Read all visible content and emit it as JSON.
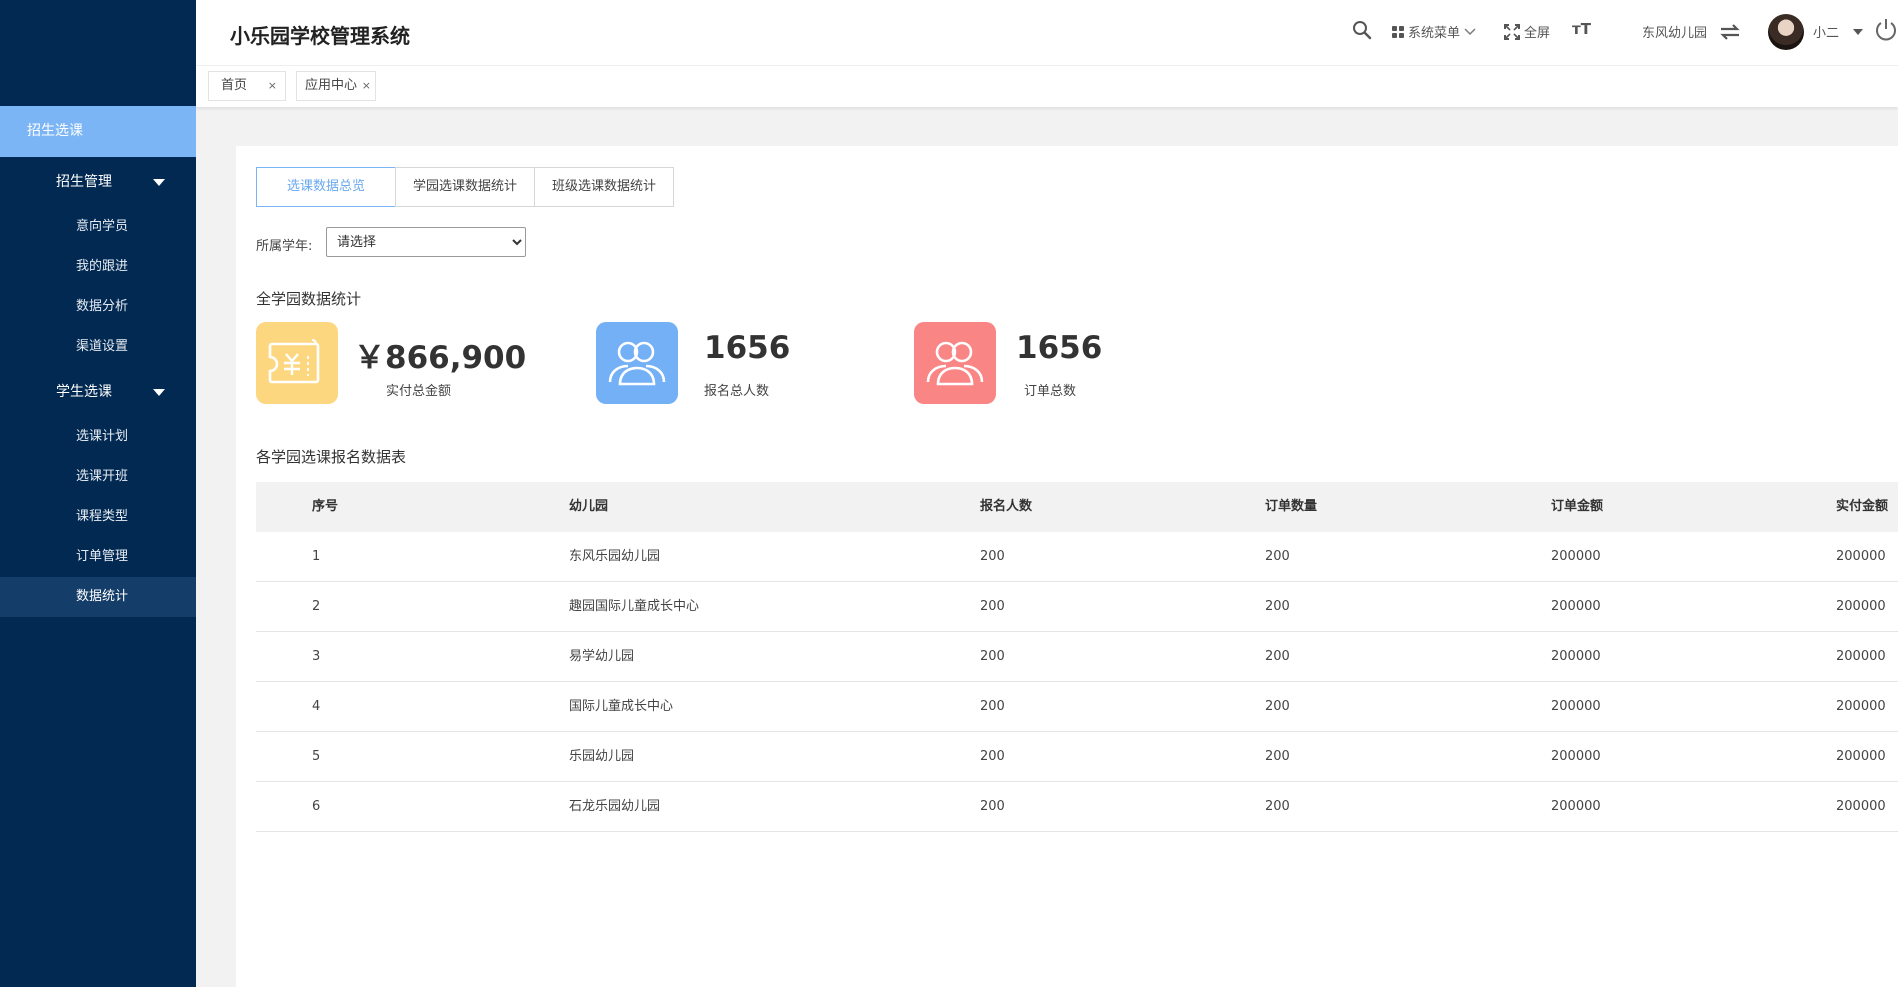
{
  "app": {
    "title": "小乐园学校管理系统"
  },
  "header": {
    "system_menu": "系统菜单",
    "fullscreen": "全屏",
    "font_size_icon_text": "ᴛT",
    "school": "东风幼儿园",
    "user": "小二"
  },
  "page_tabs": [
    {
      "label": "首页"
    },
    {
      "label": "应用中心"
    }
  ],
  "sidebar": {
    "section": "招生选课",
    "groups": [
      {
        "label": "招生管理",
        "items": [
          "意向学员",
          "我的跟进",
          "数据分析",
          "渠道设置"
        ]
      },
      {
        "label": "学生选课",
        "items": [
          "选课计划",
          "选课开班",
          "课程类型",
          "订单管理",
          "数据统计"
        ]
      }
    ],
    "active_item": "数据统计"
  },
  "sub_tabs": [
    {
      "label": "选课数据总览",
      "active": true
    },
    {
      "label": "学园选课数据统计",
      "active": false
    },
    {
      "label": "班级选课数据统计",
      "active": false
    }
  ],
  "filter": {
    "label": "所属学年:",
    "selected": "请选择"
  },
  "overview": {
    "title": "全学园数据统计",
    "stats": [
      {
        "value": "￥866,900",
        "label": "实付总金额",
        "color": "#fdd77f",
        "icon": "invoice-icon"
      },
      {
        "value": "1656",
        "label": "报名总人数",
        "color": "#74b0f5",
        "icon": "users-icon"
      },
      {
        "value": "1656",
        "label": "订单总数",
        "color": "#f98585",
        "icon": "users-icon"
      }
    ]
  },
  "table": {
    "title": "各学园选课报名数据表",
    "columns": [
      "序号",
      "幼儿园",
      "报名人数",
      "订单数量",
      "订单金额",
      "实付金额"
    ],
    "rows": [
      [
        "1",
        "东风乐园幼儿园",
        "200",
        "200",
        "200000",
        "200000"
      ],
      [
        "2",
        "趣园国际儿童成长中心",
        "200",
        "200",
        "200000",
        "200000"
      ],
      [
        "3",
        "易学幼儿园",
        "200",
        "200",
        "200000",
        "200000"
      ],
      [
        "4",
        "国际儿童成长中心",
        "200",
        "200",
        "200000",
        "200000"
      ],
      [
        "5",
        "乐园幼儿园",
        "200",
        "200",
        "200000",
        "200000"
      ],
      [
        "6",
        "石龙乐园幼儿园",
        "200",
        "200",
        "200000",
        "200000"
      ]
    ]
  }
}
